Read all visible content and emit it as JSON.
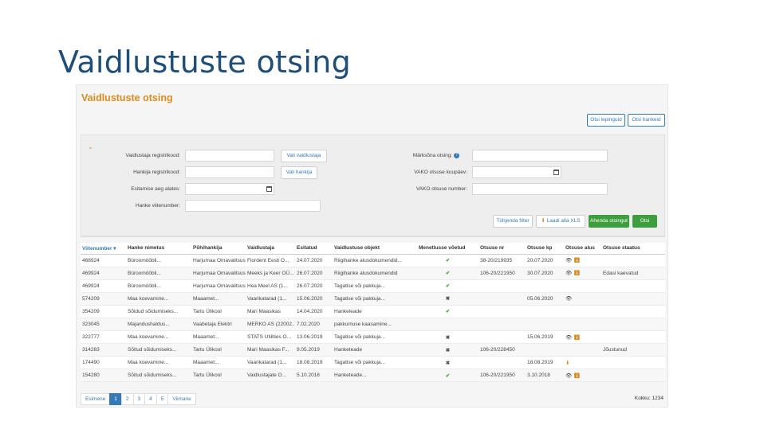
{
  "slide_title": "Vaidlustuste otsing",
  "app": {
    "title": "Vaidlustuste otsing",
    "top_buttons": {
      "contracts": "Otsi lepinguid",
      "procurements": "Otsi hankeid"
    }
  },
  "search": {
    "fields_left": [
      {
        "label": "Vaidlustaja registrikood:",
        "button": "Vali vaidlustaja"
      },
      {
        "label": "Hankija registrikood:",
        "button": "Vali hankija"
      },
      {
        "label": "Esitamise aeg alates:",
        "button": ""
      },
      {
        "label": "Hanke viitenumber:",
        "button": ""
      }
    ],
    "fields_right": [
      {
        "label": "Märksõna otsing:"
      },
      {
        "label": "VAKO otsuse kuupäev:"
      },
      {
        "label": "VAKO otsuse number:"
      }
    ],
    "actions": {
      "reset": "Tühjenda filter",
      "export": "Laadi alla XLS",
      "show_more": "Ahenda otsingut",
      "search": "Otsi"
    }
  },
  "table": {
    "columns": [
      "Viitenumber",
      "Hanke nimetus",
      "Põhihankija",
      "Vaidlustaja",
      "Esitatud",
      "Vaidlustuse objekt",
      "Menetlusse võetud",
      "Otsuse nr",
      "Otsuse kp",
      "Otsuse alus",
      "Otsuse staatus"
    ],
    "rows": [
      [
        "468924",
        "Büroomööbli...",
        "Harjumaa Omavalitsuste...",
        "Fiordent Eesti O...",
        "24.07.2020",
        "Riigihanke alusdokumendid...",
        "ok",
        "38-20/219935",
        "20.07.2020",
        "eye-dl",
        ""
      ],
      [
        "469924",
        "Büroomööbli...",
        "Harjumaa Omavalitsuste...",
        "Meeks ja Keer OÜ...",
        "26.07.2020",
        "Riigihanke alusdokumendid",
        "ok",
        "106-20/221950",
        "30.07.2020",
        "eye-dl",
        "Edasi kaevatud"
      ],
      [
        "469924",
        "Büroomööbli...",
        "Harjumaa Omavalitsuste...",
        "Hea Meel AS (1...",
        "26.07.2020",
        "Tagatise või pakkuja...",
        "ok",
        "",
        "",
        "",
        ""
      ],
      [
        "574209",
        "Maa koevamine...",
        "Maaamet...",
        "Vaarikatarad (1...",
        "15.06.2020",
        "Tagatise või pakkuja...",
        "no",
        "",
        "05.06.2020",
        "eye",
        ""
      ],
      [
        "354209",
        "Sõidud sõidumiseks...",
        "Tartu Ülikool",
        "Mari Maasikas",
        "14.04.2020",
        "Hankeleade",
        "ok",
        "",
        "",
        "",
        ""
      ],
      [
        "323045",
        "Majandushaldus...",
        "Vaabetaja Elektri",
        "MERKO AS (22002...",
        "7.02.2020",
        "pakkumuse kaasamine...",
        "",
        "",
        "",
        "",
        ""
      ],
      [
        "322777",
        "Maa koevamine...",
        "Maaamet...",
        "STATS Utilities O...",
        "13.06.2019",
        "Tagatise või pakkuja...",
        "no",
        "",
        "15.06.2019",
        "eye-dl",
        ""
      ],
      [
        "314283",
        "Sõitud sõidumiseks...",
        "Tartu Ülikool",
        "Mari Maasikas F...",
        "9.05.2019",
        "Hanketeade",
        "no",
        "106-20/228450",
        "",
        "",
        "Jõustunud"
      ],
      [
        "174490",
        "Maa koevamine...",
        "Maaamet...",
        "Vaarikatarad (1...",
        "18.08.2019",
        "Tagatise või pakkuja...",
        "no",
        "",
        "18.08.2019",
        "dl",
        ""
      ],
      [
        "154280",
        "Sõitud sõidumiseks...",
        "Tartu Ülikool",
        "Vaidlustajate O...",
        "5.10.2018",
        "Hanketeade...",
        "ok",
        "106-20/221950",
        "3.10.2018",
        "eye-dl",
        ""
      ]
    ]
  },
  "pager": {
    "first": "Esimene",
    "pages": [
      "1",
      "2",
      "3",
      "4",
      "5"
    ],
    "last": "Viimane",
    "active": "1"
  },
  "total": "Kokku: 1234",
  "colors": {
    "accent": "#d98c1e",
    "link": "#337ab7",
    "ok": "#3c9e3c",
    "title": "#1f4e79"
  }
}
